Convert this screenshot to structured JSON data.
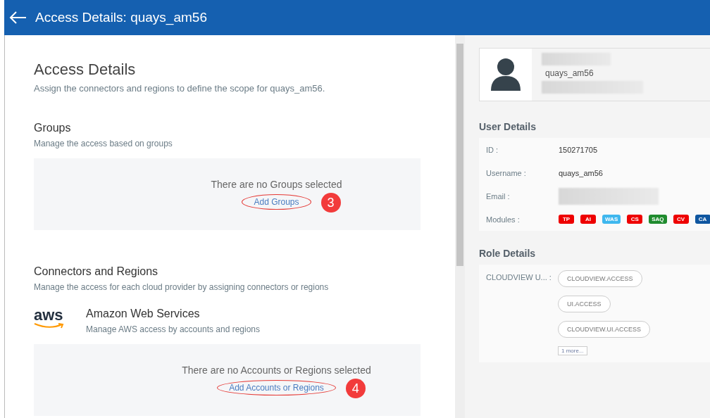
{
  "header": {
    "title": "Access Details: quays_am56"
  },
  "main": {
    "title": "Access Details",
    "subtitle": "Assign the connectors and regions to define the scope for quays_am56.",
    "groups": {
      "title": "Groups",
      "subtitle": "Manage the access based on groups",
      "empty_text": "There are no Groups selected",
      "link": "Add Groups",
      "callout": "3"
    },
    "connectors": {
      "title": "Connectors and Regions",
      "subtitle": "Manage the access for each cloud provider by assigning connectors or regions",
      "provider": {
        "logo": "aws",
        "name": "Amazon Web Services",
        "description": "Manage AWS access by accounts and regions",
        "empty_text": "There are no Accounts or Regions selected",
        "link": "Add Accounts or Regions",
        "callout": "4"
      }
    }
  },
  "profile": {
    "username": "quays_am56"
  },
  "user_details": {
    "title": "User Details",
    "rows": [
      {
        "kind": "text",
        "label": "ID :",
        "value": "150271705"
      },
      {
        "kind": "text",
        "label": "Username :",
        "value": "quays_am56"
      },
      {
        "kind": "redacted",
        "label": "Email :"
      },
      {
        "kind": "modules",
        "label": "Modules :",
        "modules": [
          {
            "label": "TP",
            "color": "#ee0000"
          },
          {
            "label": "AI",
            "color": "#ee0000"
          },
          {
            "label": "WAS",
            "color": "#3fb7ee"
          },
          {
            "label": "CS",
            "color": "#ee0000"
          },
          {
            "label": "SAQ",
            "color": "#1f8b2e"
          },
          {
            "label": "CV",
            "color": "#ee0000"
          },
          {
            "label": "CA",
            "color": "#0f56a0"
          }
        ]
      }
    ]
  },
  "role_details": {
    "title": "Role Details",
    "role": "CLOUDVIEW U... :",
    "permissions": [
      "CLOUDVIEW.ACCESS",
      "UI.ACCESS",
      "CLOUDVIEW.UI.ACCESS"
    ],
    "more": "1 more..."
  }
}
